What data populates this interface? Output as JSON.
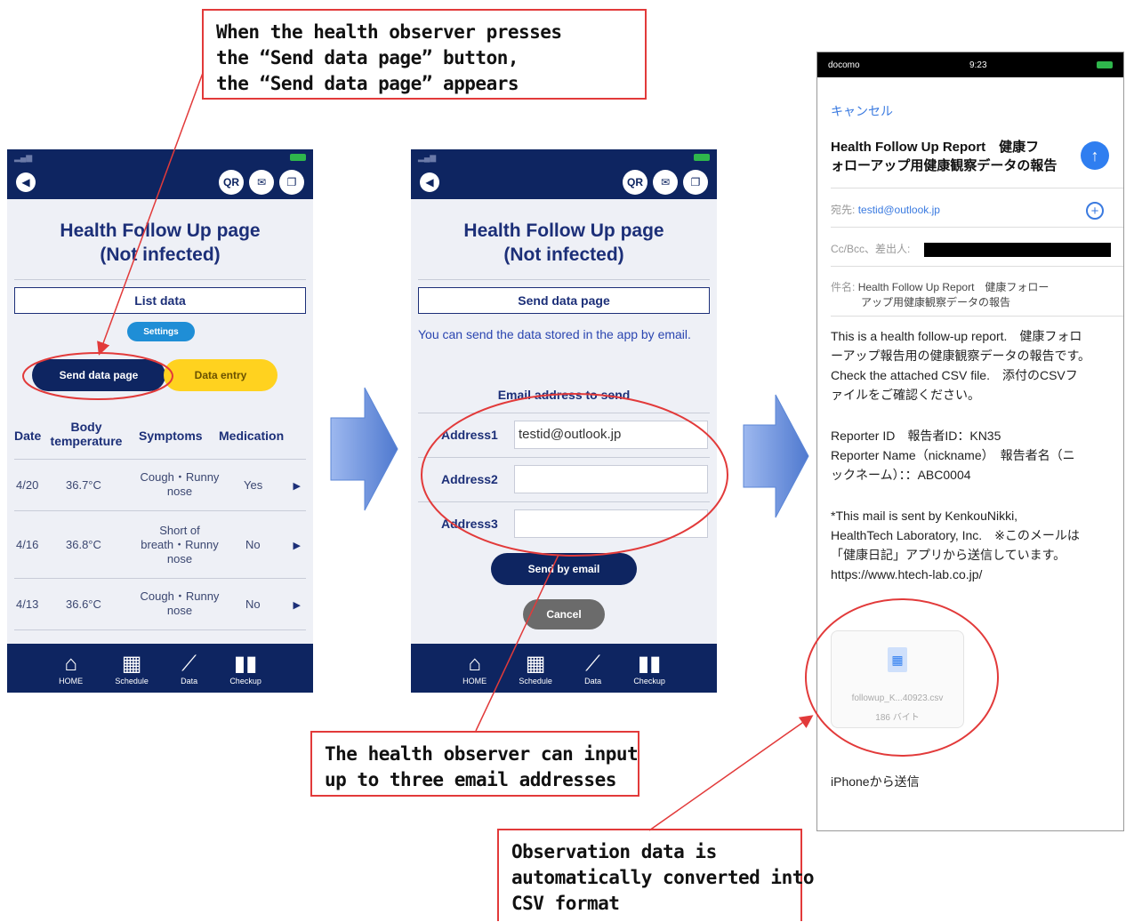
{
  "callouts": {
    "top": [
      "When the health observer presses",
      "the “Send data page” button,",
      "the “Send data page” appears"
    ],
    "middle": [
      "The health observer can input",
      "up to three email addresses"
    ],
    "bottom": [
      "Observation data is",
      "automatically converted into",
      "CSV format"
    ]
  },
  "app": {
    "nav_icons": [
      "QR",
      "✉",
      "❐"
    ],
    "title_line1": "Health Follow Up page",
    "title_line2": "(Not infected)",
    "tabs": [
      {
        "label": "HOME",
        "icon": "home-icon",
        "glyph": "⌂"
      },
      {
        "label": "Schedule",
        "icon": "calendar-icon",
        "glyph": "▦"
      },
      {
        "label": "Data",
        "icon": "chart-icon",
        "glyph": "⟋"
      },
      {
        "label": "Checkup",
        "icon": "book-icon",
        "glyph": "▮▮"
      }
    ]
  },
  "list_screen": {
    "section": "List data",
    "settings": "Settings",
    "send_data_page": "Send data page",
    "data_entry": "Data entry",
    "columns": {
      "date": "Date",
      "body": "Body",
      "temperature": "temperature",
      "symptoms": "Symptoms",
      "medication": "Medication"
    },
    "rows": [
      {
        "date": "4/20",
        "temp": "36.7°C",
        "sym1": "Cough・Runny",
        "sym2": "nose",
        "sym3": "",
        "med": "Yes"
      },
      {
        "date": "4/16",
        "temp": "36.8°C",
        "sym1": "Short of",
        "sym2": "breath・Runny",
        "sym3": "nose",
        "med": "No"
      },
      {
        "date": "4/13",
        "temp": "36.6°C",
        "sym1": "Cough・Runny",
        "sym2": "nose",
        "sym3": "",
        "med": "No"
      }
    ]
  },
  "send_screen": {
    "section": "Send data page",
    "intro": "You can send the data stored in the app by email.",
    "email_label": "Email address to send",
    "addresses": [
      {
        "label": "Address1",
        "value": "testid@outlook.jp"
      },
      {
        "label": "Address2",
        "value": ""
      },
      {
        "label": "Address3",
        "value": ""
      }
    ],
    "send_button": "Send by email",
    "cancel_button": "Cancel"
  },
  "mail": {
    "status_carrier": "docomo",
    "status_time": "9:23",
    "cancel": "キャンセル",
    "subject_line1": "Health Follow Up Report　健康フ",
    "subject_line2": "ォローアップ用健康観察データの報告",
    "to_label": "宛先:",
    "to_value": "testid@outlook.jp",
    "cc_label": "Cc/Bcc、差出人:",
    "subj_label": "件名:",
    "subj_value1": "Health Follow Up Report　健康フォロー",
    "subj_value2": "アップ用健康観察データの報告",
    "body1": [
      "This is a health follow-up report.　健康フォロ",
      "ーアップ報告用の健康観察データの報告です。",
      "Check the attached CSV file.　添付のCSVフ",
      "ァイルをご確認ください。"
    ],
    "body2": [
      "Reporter ID　報告者ID：KN35",
      "Reporter Name（nickname）　報告者名（ニ",
      "ックネーム）：：ABC0004"
    ],
    "body3": [
      "*This mail is sent by KenkouNikki,",
      "HealthTech Laboratory, Inc.　※このメールは",
      "「健康日記」アプリから送信しています。",
      "https://www.htech-lab.co.jp/"
    ],
    "attachment_name": "followup_K...40923.csv",
    "attachment_size": "186 バイト",
    "footer": "iPhoneから送信"
  },
  "colors": {
    "navy": "#0e2561",
    "accent_red": "#e23a3a",
    "arrow_blue": "#5b86d6",
    "entry_yellow": "#ffd21f",
    "ios_blue": "#2f7ef0"
  }
}
